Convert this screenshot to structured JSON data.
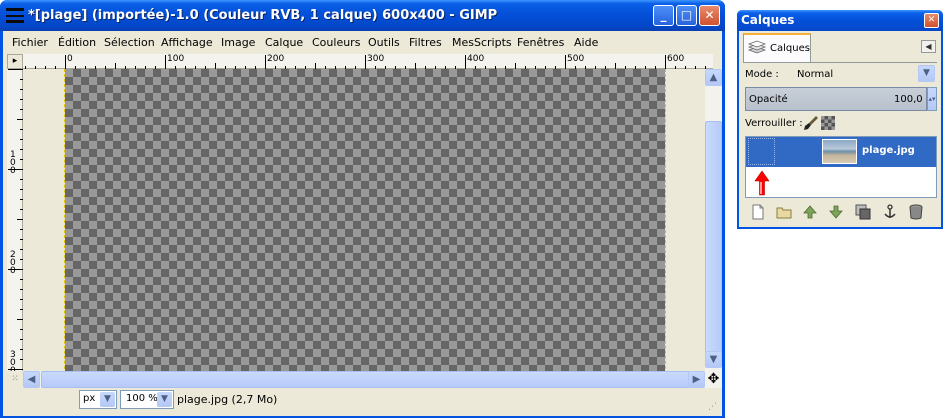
{
  "main_window": {
    "title": "*[plage] (importée)-1.0 (Couleur RVB, 1 calque) 600x400 - GIMP",
    "caption_buttons": {
      "minimize": "_",
      "maximize": "□",
      "close": "✕"
    },
    "menu": [
      "Fichier",
      "Édition",
      "Sélection",
      "Affichage",
      "Image",
      "Calque",
      "Couleurs",
      "Outils",
      "Filtres",
      "MesScripts",
      "Fenêtres",
      "Aide"
    ],
    "ruler_h_labels": [
      "0",
      "100",
      "200",
      "300",
      "400",
      "500",
      "600"
    ],
    "ruler_v_labels": [
      "1\n0\n0",
      "2\n0\n0",
      "3\n0\n0"
    ],
    "unit": "px",
    "zoom": "100 %",
    "status": "plage.jpg (2,7 Mo)"
  },
  "layers_dialog": {
    "title": "Calques",
    "tab_label": "Calques",
    "mode_label": "Mode :",
    "mode_value": "Normal",
    "opacity_label": "Opacité",
    "opacity_value": "100,0",
    "lock_label": "Verrouiller :",
    "layer_name": "plage.jpg"
  },
  "icons": {
    "paintbrush": "brush-icon",
    "checker": "alpha-lock-icon",
    "new_layer": "new-layer-icon",
    "new_group": "folder-icon",
    "raise": "raise-layer-icon",
    "lower": "lower-layer-icon",
    "duplicate": "duplicate-layer-icon",
    "anchor": "anchor-icon",
    "delete": "trash-icon"
  },
  "colors": {
    "xp_blue": "#0054e3",
    "selection": "#316ac5",
    "guide": "#e6c300",
    "arrow": "#ff0000"
  }
}
